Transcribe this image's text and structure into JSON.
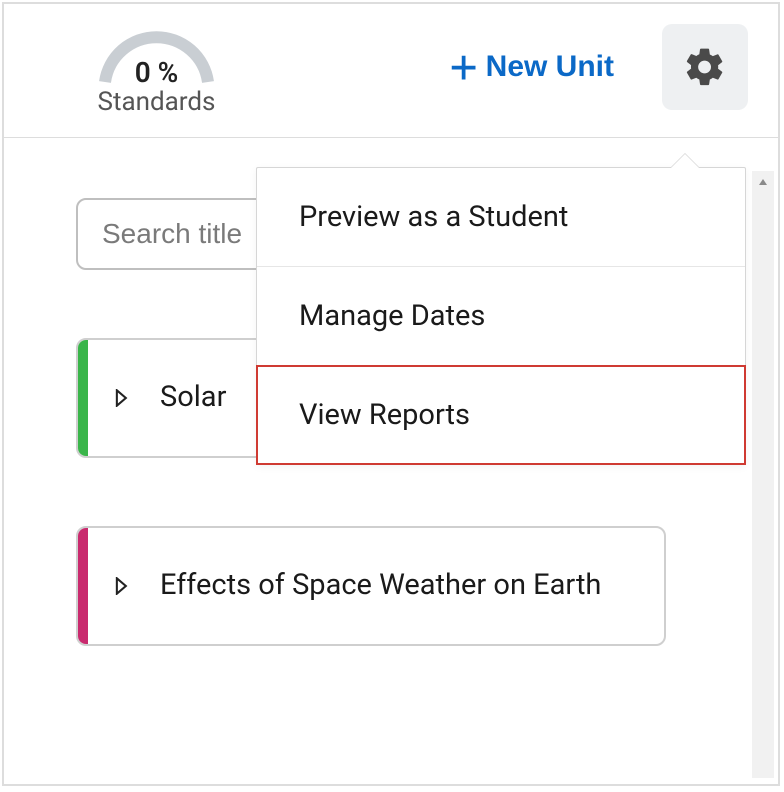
{
  "topbar": {
    "gauge_percent": "0 %",
    "gauge_label": "Standards",
    "new_unit_label": "New Unit"
  },
  "search": {
    "placeholder": "Search title"
  },
  "units": [
    {
      "title": "Solar",
      "stripe": "green"
    },
    {
      "title": "Effects of Space Weather on Earth",
      "stripe": "pink"
    }
  ],
  "gear_menu": {
    "items": [
      {
        "label": "Preview as a Student",
        "highlight": false
      },
      {
        "label": "Manage Dates",
        "highlight": false
      },
      {
        "label": "View Reports",
        "highlight": true
      }
    ]
  }
}
